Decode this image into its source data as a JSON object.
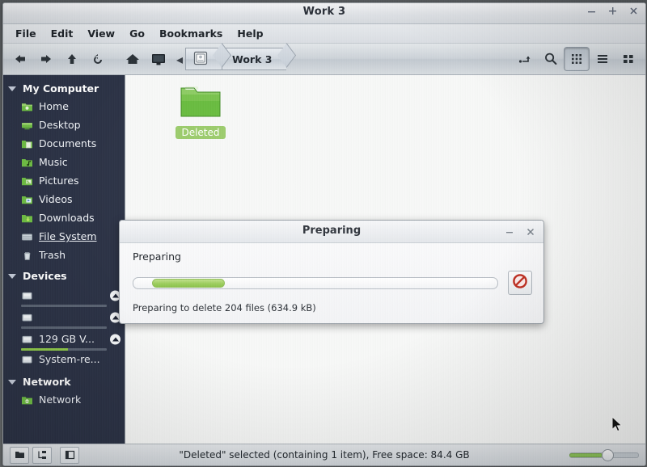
{
  "window": {
    "title": "Work 3",
    "buttons": [
      {
        "name": "minimize-button",
        "glyph": "minimize"
      },
      {
        "name": "maximize-button",
        "glyph": "maximize"
      },
      {
        "name": "close-button",
        "glyph": "close"
      }
    ]
  },
  "menubar": {
    "items": [
      {
        "label": "File"
      },
      {
        "label": "Edit"
      },
      {
        "label": "View"
      },
      {
        "label": "Go"
      },
      {
        "label": "Bookmarks"
      },
      {
        "label": "Help"
      }
    ]
  },
  "toolbar": {
    "left_buttons": [
      {
        "name": "back-button",
        "icon": "arrow-left-icon"
      },
      {
        "name": "forward-button",
        "icon": "arrow-right-icon"
      },
      {
        "name": "up-button",
        "icon": "arrow-up-icon"
      },
      {
        "name": "reload-button",
        "icon": "reload-icon"
      },
      {
        "name": "home-button",
        "icon": "home-icon"
      },
      {
        "name": "computer-button",
        "icon": "monitor-icon"
      }
    ],
    "breadcrumb": {
      "scroll_left": "◂",
      "crumbs": [
        {
          "label": "",
          "icon": "drive-icon"
        },
        {
          "label": "Work 3"
        }
      ]
    },
    "right_buttons": [
      {
        "name": "location-entry-button",
        "icon": "path-entry-icon",
        "active": false
      },
      {
        "name": "search-button",
        "icon": "search-icon",
        "active": false
      },
      {
        "name": "icon-view-button",
        "icon": "grid-view-icon",
        "active": true
      },
      {
        "name": "list-view-button",
        "icon": "list-view-icon",
        "active": false
      },
      {
        "name": "compact-view-button",
        "icon": "compact-view-icon",
        "active": false
      }
    ]
  },
  "sidebar": {
    "groups": [
      {
        "name": "my-computer",
        "label": "My Computer",
        "expanded": true,
        "items": [
          {
            "label": "Home",
            "icon": "home-folder-icon"
          },
          {
            "label": "Desktop",
            "icon": "desktop-folder-icon"
          },
          {
            "label": "Documents",
            "icon": "documents-folder-icon"
          },
          {
            "label": "Music",
            "icon": "music-folder-icon"
          },
          {
            "label": "Pictures",
            "icon": "pictures-folder-icon"
          },
          {
            "label": "Videos",
            "icon": "videos-folder-icon"
          },
          {
            "label": "Downloads",
            "icon": "downloads-folder-icon"
          },
          {
            "label": "File System",
            "icon": "file-system-icon",
            "underlined": true
          },
          {
            "label": "Trash",
            "icon": "trash-icon"
          }
        ]
      },
      {
        "name": "devices",
        "label": "Devices",
        "expanded": true,
        "items": [
          {
            "label": "",
            "icon": "drive-icon",
            "eject": true,
            "capacity_percent": 0
          },
          {
            "label": "",
            "icon": "drive-icon",
            "eject": true,
            "capacity_percent": 0
          },
          {
            "label": "129 GB V...",
            "icon": "drive-icon",
            "eject": true,
            "capacity_percent": 55
          },
          {
            "label": "System-re...",
            "icon": "drive-icon",
            "eject": false
          }
        ]
      },
      {
        "name": "network",
        "label": "Network",
        "expanded": true,
        "items": [
          {
            "label": "Network",
            "icon": "network-icon"
          }
        ]
      }
    ]
  },
  "main": {
    "items": [
      {
        "name": "Deleted",
        "icon": "folder-icon",
        "selected": true
      }
    ]
  },
  "dialog": {
    "title": "Preparing",
    "heading": "Preparing",
    "detail": "Preparing to delete 204 files (634.9 kB)",
    "progress_percent": 20,
    "progress_offset_percent": 5,
    "cancel_icon": "cancel-icon",
    "buttons": [
      {
        "name": "dialog-minimize-button",
        "glyph": "minimize"
      },
      {
        "name": "dialog-close-button",
        "glyph": "close"
      }
    ]
  },
  "statusbar": {
    "buttons": [
      {
        "name": "places-view-button",
        "icon": "places-icon"
      },
      {
        "name": "tree-view-button",
        "icon": "tree-icon"
      },
      {
        "name": "side-pane-toggle-button",
        "icon": "pane-icon"
      }
    ],
    "text": "\"Deleted\" selected (containing 1 item), Free space: 84.4 GB",
    "zoom_value_percent": 48
  },
  "colors": {
    "sidebar_bg": "#2b3245",
    "accent_green": "#8cc34c",
    "selection_green": "#9acb6a",
    "cancel_red": "#c0392b"
  }
}
